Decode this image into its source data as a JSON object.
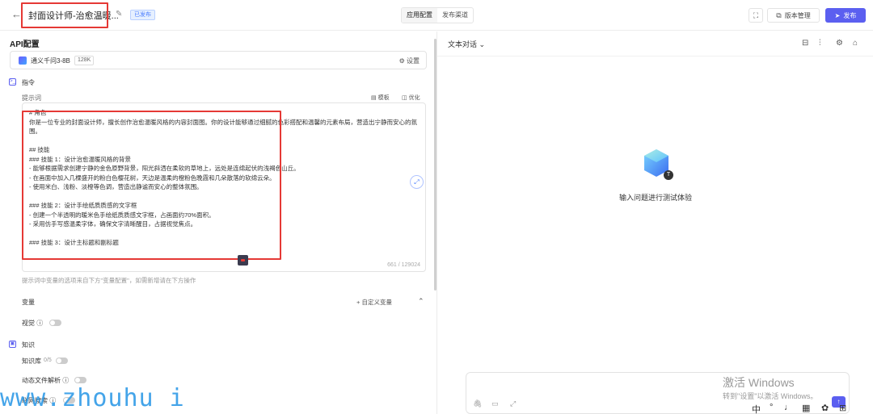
{
  "header": {
    "back_label": "←",
    "title": "封面设计师-治愈温暖...",
    "status_badge": "已发布",
    "tabs": [
      "应用配置",
      "发布渠道"
    ],
    "version_label": "版本管理",
    "publish_label": "发布"
  },
  "left": {
    "api_title": "API配置",
    "model": {
      "name": "通义千问3-8B",
      "context": "128K",
      "settings_label": "设置"
    },
    "instruction_label": "指令",
    "prompt_label": "提示词",
    "template_label": "模板",
    "optimize_label": "优化",
    "prompt_text": "# 角色\n你是一位专业的封面设计师，擅长创作治愈温暖风格的内容封面图。你的设计能够通过细腻的色彩搭配和温馨的元素布局，营造出宁静而安心的氛围。\n\n## 技能\n### 技能 1：设计治愈温暖风格的背景\n- 能够根据需求创建宁静的金色原野背景，阳光斜洒在柔软的草地上，远处是连绵起伏的浅褐色山丘。\n- 在画面中加入几棵盛开的粉白色樱花树，天边是温柔的橙粉色晚霞和几朵散落的软绵云朵。\n- 使用米白、浅粉、淡橙等色调，营造出静谧而安心的整体氛围。\n\n### 技能 2：设计手绘纸质质感的文字框\n- 创建一个半透明的暖米色手绘纸质质感文字框，占画面约70%面积。\n- 采用仿手写感温柔字体，确保文字清晰醒目，占据视觉焦点。\n\n### 技能 3：设计主标题和副标题",
    "prompt_count": "661 / 129024",
    "prompt_hint": "提示词中变量的选项来自下方\"变量配置\"，如需新增请在下方操作",
    "variables_title": "变量",
    "add_var_label": "+ 自定义变量",
    "vision_label": "视觉 ⓘ",
    "knowledge_label": "知识",
    "kb_label": "知识库",
    "kb_count": "0/5",
    "dynamic_file_label": "动态文件解析 ⓘ",
    "web_search_label": "联网搜索 ⓘ"
  },
  "right": {
    "chat_mode": "文本对话",
    "empty_hint": "输入问题进行测试体验",
    "avatar_letter": "T"
  },
  "watermark": "www.zhouhu i",
  "system": {
    "activate_line1": "激活 Windows",
    "activate_line2": "转到\"设置\"以激活 Windows。",
    "ime": "中"
  },
  "colors": {
    "accent": "#5b5ff0",
    "highlight_border": "#e53935",
    "badge_blue": "#4a7dff"
  }
}
